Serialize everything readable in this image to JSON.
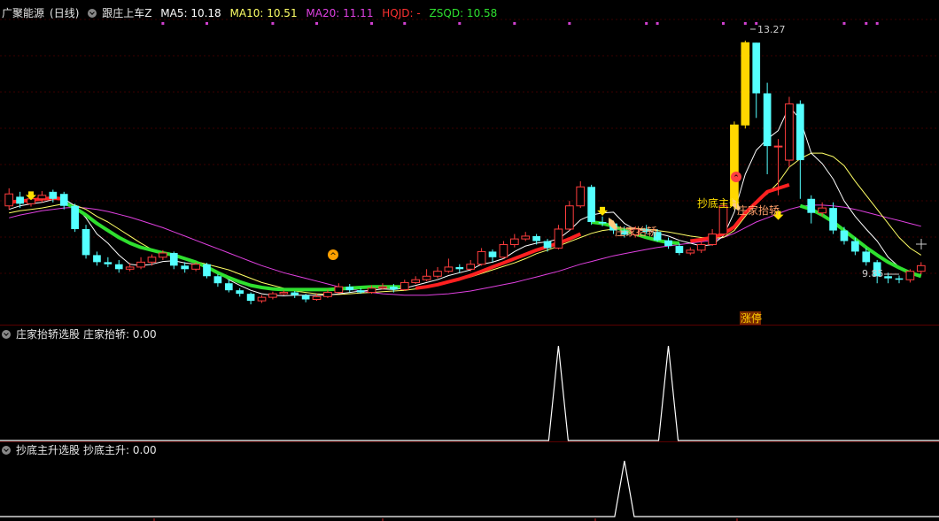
{
  "header": {
    "stock": "广聚能源",
    "period": "(日线)",
    "indicator": "跟庄上车Z",
    "ma5": "MA5: 10.18",
    "ma10": "MA10: 10.51",
    "ma20": "MA20: 11.11",
    "hqjd": "HQJD: -",
    "zsqd": "ZSQD: 10.58"
  },
  "panel2": {
    "title": "庄家抬轿选股",
    "value": "庄家抬轿: 0.00"
  },
  "panel3": {
    "title": "抄底主升选股",
    "value": "抄底主升: 0.00"
  },
  "annotations": {
    "high": "13.27",
    "low": "9.85",
    "zt": "涨停",
    "zjtj": "庄家抬轿",
    "cdzs": "抄底主升"
  },
  "colors": {
    "up": "#ff3d3d",
    "down": "#54ffff",
    "ma5": "#ffffff",
    "ma10": "#ffff66",
    "ma20": "#e040e0",
    "hqjd": "#ff2020",
    "zsqd": "#2fe02f"
  },
  "chart_data": {
    "type": "candlestick",
    "ylim": [
      9.4,
      13.6
    ],
    "candles": [
      [
        10.95,
        11.12,
        11.2,
        10.9
      ],
      [
        11.08,
        10.98,
        11.15,
        10.92
      ],
      [
        10.98,
        11.05,
        11.12,
        10.94
      ],
      [
        11.05,
        11.1,
        11.16,
        11.0
      ],
      [
        11.15,
        11.05,
        11.18,
        11.0
      ],
      [
        11.12,
        10.95,
        11.15,
        10.9
      ],
      [
        10.95,
        10.62,
        10.98,
        10.58
      ],
      [
        10.62,
        10.25,
        10.68,
        10.2
      ],
      [
        10.25,
        10.15,
        10.3,
        10.1
      ],
      [
        10.15,
        10.12,
        10.22,
        10.08
      ],
      [
        10.12,
        10.05,
        10.18,
        10.0
      ],
      [
        10.05,
        10.08,
        10.14,
        10.02
      ],
      [
        10.08,
        10.15,
        10.22,
        10.05
      ],
      [
        10.15,
        10.22,
        10.26,
        10.1
      ],
      [
        10.22,
        10.28,
        10.32,
        10.18
      ],
      [
        10.28,
        10.1,
        10.3,
        10.05
      ],
      [
        10.1,
        10.05,
        10.15,
        10.0
      ],
      [
        10.05,
        10.12,
        10.15,
        10.02
      ],
      [
        10.12,
        9.95,
        10.14,
        9.92
      ],
      [
        9.95,
        9.85,
        9.98,
        9.8
      ],
      [
        9.85,
        9.75,
        9.9,
        9.72
      ],
      [
        9.75,
        9.7,
        9.78,
        9.66
      ],
      [
        9.7,
        9.6,
        9.72,
        9.55
      ],
      [
        9.6,
        9.65,
        9.68,
        9.57
      ],
      [
        9.65,
        9.7,
        9.73,
        9.62
      ],
      [
        9.7,
        9.72,
        9.75,
        9.68
      ],
      [
        9.72,
        9.68,
        9.74,
        9.64
      ],
      [
        9.68,
        9.62,
        9.7,
        9.58
      ],
      [
        9.62,
        9.66,
        9.7,
        9.6
      ],
      [
        9.66,
        9.72,
        9.76,
        9.64
      ],
      [
        9.72,
        9.8,
        9.85,
        9.7
      ],
      [
        9.8,
        9.75,
        9.84,
        9.72
      ],
      [
        9.75,
        9.72,
        9.78,
        9.7
      ],
      [
        9.72,
        9.78,
        9.82,
        9.7
      ],
      [
        9.78,
        9.8,
        9.85,
        9.76
      ],
      [
        9.8,
        9.76,
        9.84,
        9.72
      ],
      [
        9.76,
        9.86,
        9.9,
        9.74
      ],
      [
        9.86,
        9.9,
        9.95,
        9.84
      ],
      [
        9.9,
        9.95,
        10.05,
        9.88
      ],
      [
        9.95,
        10.02,
        10.08,
        9.92
      ],
      [
        10.02,
        10.08,
        10.2,
        10.0
      ],
      [
        10.08,
        10.05,
        10.12,
        10.0
      ],
      [
        10.05,
        10.12,
        10.18,
        10.02
      ],
      [
        10.12,
        10.3,
        10.35,
        10.1
      ],
      [
        10.3,
        10.22,
        10.33,
        10.15
      ],
      [
        10.22,
        10.4,
        10.45,
        10.2
      ],
      [
        10.4,
        10.48,
        10.55,
        10.36
      ],
      [
        10.48,
        10.52,
        10.58,
        10.45
      ],
      [
        10.52,
        10.45,
        10.55,
        10.4
      ],
      [
        10.45,
        10.35,
        10.48,
        10.3
      ],
      [
        10.35,
        10.62,
        10.68,
        10.33
      ],
      [
        10.62,
        10.95,
        11.02,
        10.6
      ],
      [
        10.95,
        11.22,
        11.3,
        10.92
      ],
      [
        11.22,
        10.72,
        11.25,
        10.68
      ],
      [
        10.72,
        10.7,
        10.8,
        10.66
      ],
      [
        10.7,
        10.6,
        10.74,
        10.55
      ],
      [
        10.6,
        10.54,
        10.66,
        10.5
      ],
      [
        10.54,
        10.62,
        10.66,
        10.5
      ],
      [
        10.62,
        10.58,
        10.68,
        10.55
      ],
      [
        10.58,
        10.46,
        10.62,
        10.44
      ],
      [
        10.46,
        10.38,
        10.5,
        10.34
      ],
      [
        10.38,
        10.28,
        10.42,
        10.25
      ],
      [
        10.28,
        10.32,
        10.36,
        10.25
      ],
      [
        10.32,
        10.4,
        10.45,
        10.28
      ],
      [
        10.4,
        10.55,
        10.62,
        10.38
      ],
      [
        10.55,
        10.95,
        11.0,
        10.52
      ],
      [
        10.95,
        12.1,
        12.15,
        10.9
      ],
      [
        12.1,
        13.27,
        13.3,
        12.05
      ],
      [
        13.27,
        12.55,
        13.27,
        12.2
      ],
      [
        12.55,
        11.8,
        12.7,
        11.4
      ],
      [
        11.8,
        11.8,
        11.9,
        11.1
      ],
      [
        11.6,
        12.4,
        12.5,
        11.5
      ],
      [
        12.4,
        11.6,
        12.45,
        11.05
      ],
      [
        11.05,
        10.85,
        11.1,
        10.7
      ],
      [
        10.85,
        10.92,
        11.0,
        10.8
      ],
      [
        10.92,
        10.6,
        11.0,
        10.55
      ],
      [
        10.6,
        10.45,
        10.65,
        10.4
      ],
      [
        10.45,
        10.3,
        10.5,
        10.25
      ],
      [
        10.3,
        10.15,
        10.35,
        10.1
      ],
      [
        10.15,
        9.95,
        10.18,
        9.85
      ],
      [
        9.95,
        9.92,
        10.0,
        9.85
      ],
      [
        9.92,
        9.9,
        9.96,
        9.85
      ],
      [
        9.9,
        10.02,
        10.05,
        9.86
      ],
      [
        10.02,
        10.1,
        10.15,
        9.98
      ]
    ],
    "ma5_series": [
      10.9,
      10.95,
      10.98,
      11.0,
      11.04,
      11.05,
      10.95,
      10.78,
      10.55,
      10.42,
      10.25,
      10.12,
      10.1,
      10.12,
      10.16,
      10.17,
      10.14,
      10.12,
      10.08,
      10.0,
      9.9,
      9.82,
      9.75,
      9.7,
      9.68,
      9.67,
      9.68,
      9.68,
      9.68,
      9.68,
      9.7,
      9.72,
      9.74,
      9.75,
      9.77,
      9.76,
      9.78,
      9.82,
      9.86,
      9.9,
      9.96,
      10.0,
      10.04,
      10.12,
      10.15,
      10.2,
      10.3,
      10.38,
      10.42,
      10.44,
      10.48,
      10.6,
      10.75,
      10.82,
      10.85,
      10.86,
      10.7,
      10.61,
      10.62,
      10.56,
      10.52,
      10.46,
      10.42,
      10.38,
      10.4,
      10.52,
      10.86,
      11.4,
      11.74,
      11.9,
      12.02,
      12.36,
      12.18,
      11.7,
      11.55,
      11.33,
      11.02,
      10.8,
      10.62,
      10.45,
      10.22,
      10.08,
      9.96,
      9.98
    ],
    "ma10_series": [
      10.85,
      10.88,
      10.9,
      10.92,
      10.95,
      10.98,
      10.96,
      10.9,
      10.8,
      10.72,
      10.62,
      10.52,
      10.42,
      10.33,
      10.28,
      10.24,
      10.2,
      10.16,
      10.12,
      10.08,
      10.04,
      9.98,
      9.92,
      9.86,
      9.82,
      9.78,
      9.74,
      9.72,
      9.7,
      9.69,
      9.69,
      9.7,
      9.71,
      9.72,
      9.73,
      9.74,
      9.75,
      9.77,
      9.8,
      9.83,
      9.86,
      9.9,
      9.94,
      9.99,
      10.04,
      10.09,
      10.14,
      10.2,
      10.27,
      10.32,
      10.38,
      10.44,
      10.5,
      10.56,
      10.6,
      10.62,
      10.62,
      10.63,
      10.62,
      10.6,
      10.58,
      10.55,
      10.52,
      10.5,
      10.49,
      10.5,
      10.6,
      10.8,
      11.0,
      11.12,
      11.28,
      11.5,
      11.62,
      11.7,
      11.7,
      11.65,
      11.52,
      11.3,
      11.1,
      10.9,
      10.7,
      10.5,
      10.35,
      10.25
    ],
    "ma20_series": [
      10.78,
      10.82,
      10.85,
      10.88,
      10.9,
      10.92,
      10.93,
      10.92,
      10.9,
      10.87,
      10.83,
      10.79,
      10.74,
      10.69,
      10.64,
      10.58,
      10.52,
      10.46,
      10.4,
      10.34,
      10.28,
      10.22,
      10.16,
      10.1,
      10.05,
      10.0,
      9.96,
      9.92,
      9.88,
      9.84,
      9.8,
      9.77,
      9.74,
      9.72,
      9.7,
      9.69,
      9.68,
      9.68,
      9.68,
      9.69,
      9.7,
      9.72,
      9.74,
      9.77,
      9.8,
      9.83,
      9.86,
      9.9,
      9.94,
      9.98,
      10.02,
      10.07,
      10.12,
      10.16,
      10.2,
      10.24,
      10.27,
      10.3,
      10.33,
      10.36,
      10.38,
      10.4,
      10.42,
      10.44,
      10.46,
      10.5,
      10.56,
      10.64,
      10.72,
      10.78,
      10.84,
      10.9,
      10.94,
      10.96,
      10.96,
      10.95,
      10.93,
      10.9,
      10.86,
      10.82,
      10.78,
      10.74,
      10.7,
      10.66
    ],
    "hqjd_series": [
      11.0,
      11.02,
      11.03,
      11.05,
      11.06,
      11.05,
      null,
      null,
      null,
      null,
      null,
      null,
      null,
      null,
      null,
      null,
      null,
      null,
      null,
      null,
      null,
      null,
      null,
      null,
      null,
      null,
      null,
      null,
      null,
      null,
      null,
      null,
      null,
      null,
      null,
      null,
      null,
      9.78,
      9.8,
      9.83,
      9.87,
      9.91,
      9.96,
      10.02,
      10.08,
      10.14,
      10.2,
      10.26,
      10.32,
      10.37,
      10.42,
      10.48,
      10.55,
      null,
      null,
      null,
      null,
      null,
      null,
      null,
      null,
      null,
      10.45,
      10.47,
      10.5,
      10.55,
      10.65,
      10.85,
      11.0,
      11.15,
      11.2,
      11.25,
      null,
      null,
      null,
      null,
      null,
      null,
      null,
      null,
      null,
      null,
      null,
      null
    ],
    "zsqd_series": [
      null,
      null,
      null,
      null,
      null,
      11.0,
      10.92,
      10.82,
      10.7,
      10.6,
      10.5,
      10.42,
      10.36,
      10.32,
      10.28,
      10.25,
      10.2,
      10.15,
      10.08,
      10.0,
      9.93,
      9.87,
      9.82,
      9.79,
      9.77,
      9.76,
      9.76,
      9.76,
      9.76,
      9.76,
      9.77,
      9.78,
      9.79,
      9.8,
      9.8,
      9.8,
      9.8,
      null,
      null,
      null,
      null,
      null,
      null,
      null,
      null,
      null,
      null,
      null,
      null,
      null,
      null,
      null,
      null,
      10.72,
      10.7,
      10.66,
      10.6,
      10.55,
      10.5,
      10.46,
      10.43,
      10.42,
      null,
      null,
      null,
      null,
      null,
      null,
      null,
      null,
      null,
      null,
      10.95,
      10.9,
      10.82,
      10.72,
      10.6,
      10.48,
      10.36,
      10.25,
      10.15,
      10.07,
      10.0,
      9.95
    ],
    "panel2_peaks": [
      50,
      60
    ],
    "panel3_peaks": [
      56
    ]
  }
}
